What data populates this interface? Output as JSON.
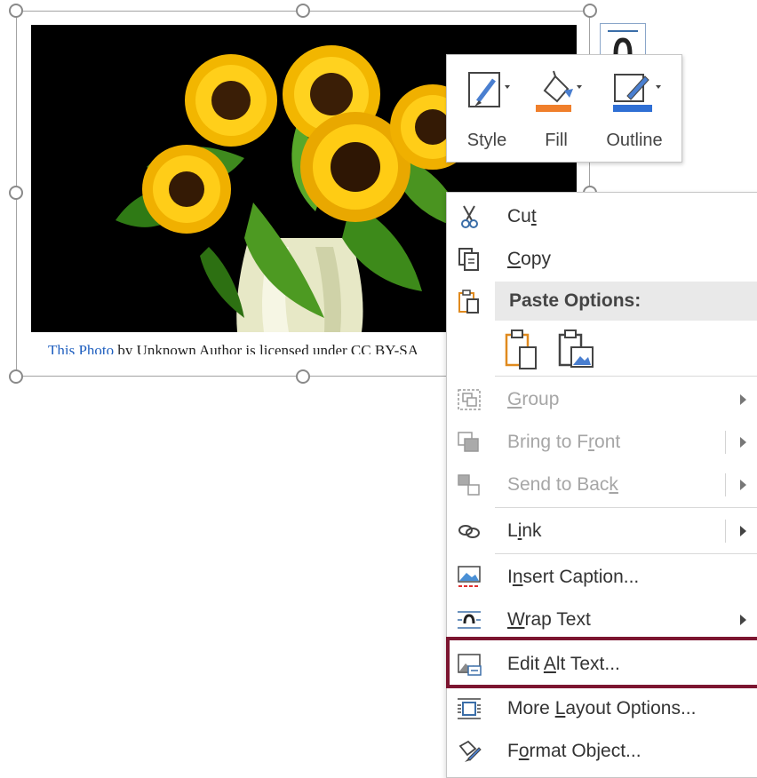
{
  "photo": {
    "credit_link": "This Photo",
    "credit_rest": " by Unknown Author is licensed under CC BY-SA"
  },
  "mini_toolbar": {
    "style_label": "Style",
    "fill_label": "Fill",
    "outline_label": "Outline",
    "fill_color": "#f07f2b",
    "outline_color": "#2f6fd4"
  },
  "context_menu": {
    "cut": {
      "pre": "Cu",
      "key": "t",
      "post": ""
    },
    "copy": {
      "pre": "",
      "key": "C",
      "post": "opy"
    },
    "paste_options": "Paste Options:",
    "group": {
      "pre": "",
      "key": "G",
      "post": "roup"
    },
    "bring_to_front": {
      "pre": "Bring to F",
      "key": "r",
      "post": "ont"
    },
    "send_to_back": {
      "pre": "Send to Bac",
      "key": "k",
      "post": ""
    },
    "link": {
      "pre": "L",
      "key": "i",
      "post": "nk"
    },
    "insert_caption": {
      "pre": "I",
      "key": "n",
      "post": "sert Caption..."
    },
    "wrap_text": {
      "pre": "",
      "key": "W",
      "post": "rap Text"
    },
    "edit_alt_text": {
      "pre": "Edit ",
      "key": "A",
      "post": "lt Text..."
    },
    "more_layout": {
      "pre": "More ",
      "key": "L",
      "post": "ayout Options..."
    },
    "format_object": {
      "pre": "F",
      "key": "o",
      "post": "rmat Object..."
    },
    "highlight_color": "#7c1530"
  }
}
